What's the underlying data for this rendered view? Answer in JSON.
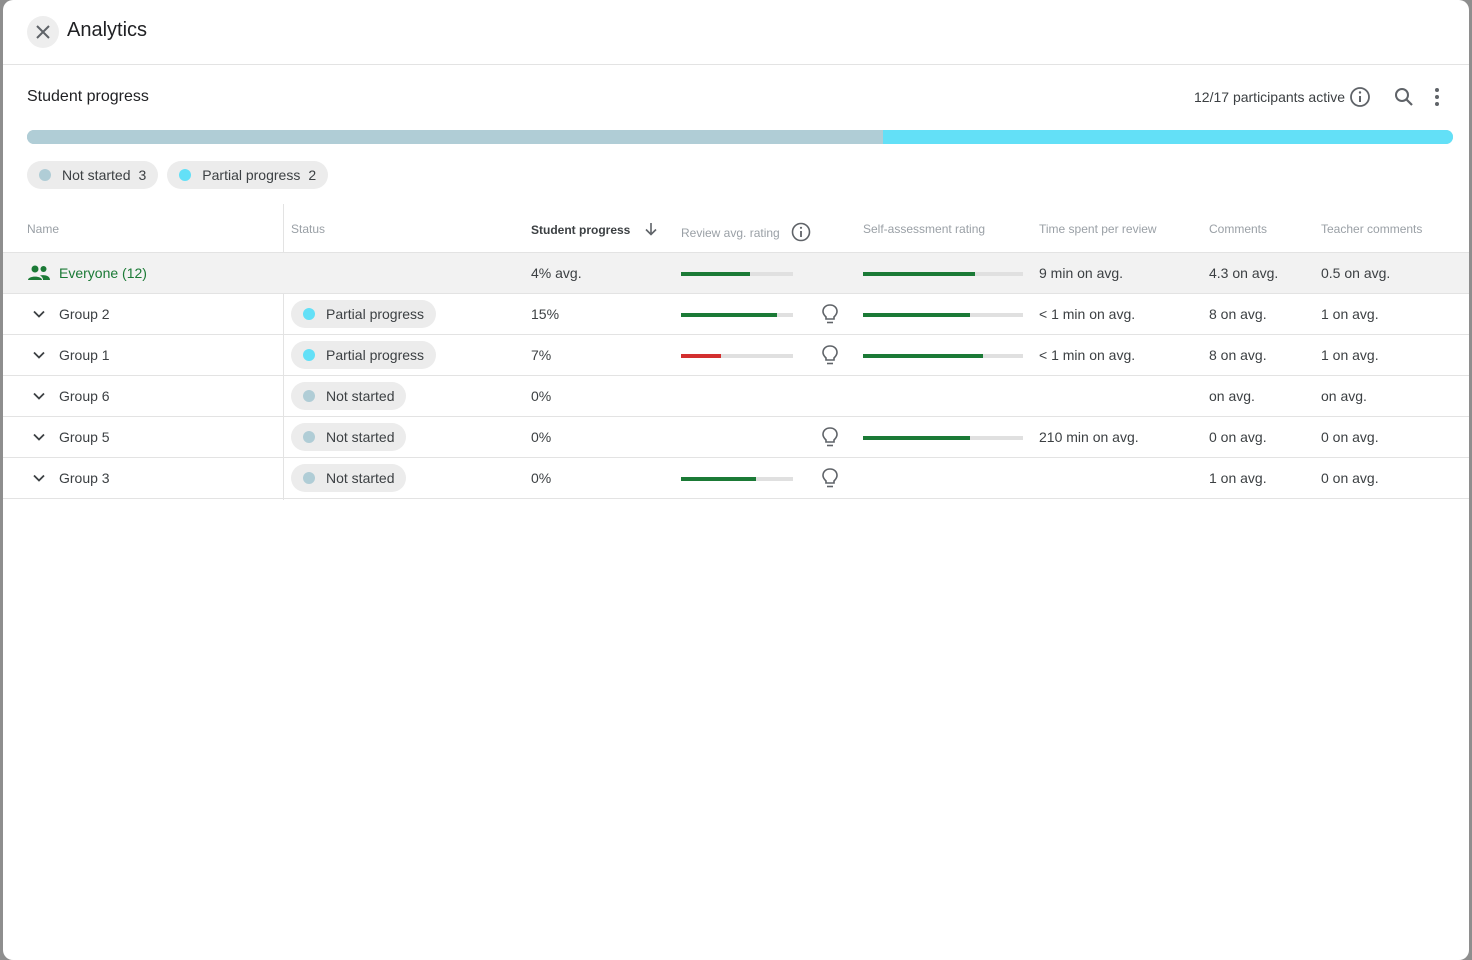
{
  "header": {
    "title": "Analytics",
    "close_icon": "close-icon"
  },
  "summary": {
    "title": "Student progress",
    "participants": "12/17 participants active",
    "not_started_fraction": 0.6,
    "partial_fraction": 0.4,
    "legend": [
      {
        "label": "Not started",
        "count": "3",
        "color": "#b0cdd6"
      },
      {
        "label": "Partial progress",
        "count": "2",
        "color": "#63e0f7"
      }
    ]
  },
  "columns": {
    "name": "Name",
    "status": "Status",
    "progress": "Student progress",
    "review": "Review avg. rating",
    "self": "Self-assessment rating",
    "time": "Time spent per review",
    "comments": "Comments",
    "teacher": "Teacher comments"
  },
  "colors": {
    "green": "#1b7a36",
    "red": "#d32f2f",
    "track": "#e0e0e0"
  },
  "rows": [
    {
      "name": "Everyone (12)",
      "status": "",
      "progress": "4% avg.",
      "review": 0.62,
      "review_color": "green",
      "bulb": false,
      "self": 0.7,
      "time": "9 min on avg.",
      "comments": "4.3 on avg.",
      "teacher": "0.5 on avg."
    },
    {
      "name": "Group 2",
      "status": "Partial progress",
      "status_type": "partial",
      "progress": "15%",
      "review": 0.86,
      "review_color": "green",
      "bulb": true,
      "self": 0.67,
      "time": "< 1 min on avg.",
      "comments": "8 on avg.",
      "teacher": "1 on avg."
    },
    {
      "name": "Group 1",
      "status": "Partial progress",
      "status_type": "partial",
      "progress": "7%",
      "review": 0.36,
      "review_color": "red",
      "bulb": true,
      "self": 0.75,
      "time": "< 1 min on avg.",
      "comments": "8 on avg.",
      "teacher": "1 on avg."
    },
    {
      "name": "Group 6",
      "status": "Not started",
      "status_type": "not",
      "progress": "0%",
      "review": null,
      "bulb": false,
      "self": null,
      "time": "",
      "comments": "on avg.",
      "teacher": "on avg."
    },
    {
      "name": "Group 5",
      "status": "Not started",
      "status_type": "not",
      "progress": "0%",
      "review": null,
      "bulb": true,
      "self": 0.67,
      "time": "210 min on avg.",
      "comments": "0 on avg.",
      "teacher": "0 on avg."
    },
    {
      "name": "Group 3",
      "status": "Not started",
      "status_type": "not",
      "progress": "0%",
      "review": 0.67,
      "review_color": "green",
      "bulb": true,
      "self": null,
      "time": "",
      "comments": "1 on avg.",
      "teacher": "0 on avg."
    }
  ]
}
